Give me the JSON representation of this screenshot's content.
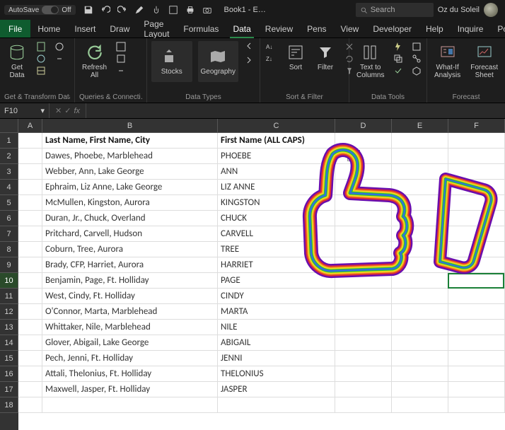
{
  "titlebar": {
    "autosave_label": "AutoSave",
    "autosave_state": "Off",
    "doc_title": "Book1 - E…",
    "search_placeholder": "Search",
    "user_name": "Oz du Soleil"
  },
  "tabs": {
    "file": "File",
    "items": [
      "Home",
      "Insert",
      "Draw",
      "Page Layout",
      "Formulas",
      "Data",
      "Review",
      "Pens",
      "View",
      "Developer",
      "Help",
      "Inquire",
      "Power"
    ],
    "active_index": 5
  },
  "ribbon": {
    "groups": {
      "get_transform": {
        "label": "Get & Transform Data",
        "get_data": "Get\nData"
      },
      "queries": {
        "label": "Queries & Connecti…",
        "refresh": "Refresh\nAll"
      },
      "data_types": {
        "label": "Data Types",
        "stocks": "Stocks",
        "geography": "Geography"
      },
      "sort_filter": {
        "label": "Sort & Filter",
        "sort": "Sort",
        "filter": "Filter"
      },
      "data_tools": {
        "label": "Data Tools",
        "text_to_columns": "Text to\nColumns"
      },
      "forecast": {
        "label": "Forecast",
        "what_if": "What-If\nAnalysis",
        "forecast_sheet": "Forecast\nSheet"
      }
    }
  },
  "namebox": {
    "ref": "F10"
  },
  "columns": [
    "A",
    "B",
    "C",
    "D",
    "E",
    "F"
  ],
  "col_classes": [
    "cA",
    "cB",
    "cC",
    "cD",
    "cE",
    "cF"
  ],
  "rows": [
    {
      "n": 1,
      "b": "Last Name, First Name, City",
      "c": "First Name (ALL CAPS)",
      "header": true
    },
    {
      "n": 2,
      "b": "Dawes, Phoebe, Marblehead",
      "c": "PHOEBE"
    },
    {
      "n": 3,
      "b": "Webber, Ann, Lake George",
      "c": "ANN"
    },
    {
      "n": 4,
      "b": "Ephraim, Liz Anne, Lake George",
      "c": "LIZ ANNE"
    },
    {
      "n": 5,
      "b": "McMullen, Kingston, Aurora",
      "c": "KINGSTON"
    },
    {
      "n": 6,
      "b": "Duran, Jr., Chuck, Overland",
      "c": "CHUCK"
    },
    {
      "n": 7,
      "b": "Pritchard, Carvell, Hudson",
      "c": "CARVELL"
    },
    {
      "n": 8,
      "b": "Coburn, Tree, Aurora",
      "c": "TREE"
    },
    {
      "n": 9,
      "b": "Brady, CFP, Harriet, Aurora",
      "c": "HARRIET"
    },
    {
      "n": 10,
      "b": "Benjamin, Page, Ft. Holliday",
      "c": "PAGE",
      "selected": true
    },
    {
      "n": 11,
      "b": "West, Cindy, Ft. Holliday",
      "c": "CINDY"
    },
    {
      "n": 12,
      "b": "O'Connor, Marta, Marblehead",
      "c": "MARTA"
    },
    {
      "n": 13,
      "b": "Whittaker, Nile, Marblehead",
      "c": "NILE"
    },
    {
      "n": 14,
      "b": "Glover, Abigail, Lake George",
      "c": "ABIGAIL"
    },
    {
      "n": 15,
      "b": "Pech, Jenni, Ft. Holliday",
      "c": "JENNI"
    },
    {
      "n": 16,
      "b": "Attali, Thelonius, Ft. Holliday",
      "c": "THELONIUS"
    },
    {
      "n": 17,
      "b": "Maxwell, Jasper, Ft. Holliday",
      "c": "JASPER"
    },
    {
      "n": 18,
      "b": "",
      "c": ""
    }
  ],
  "selected_cell": {
    "col": "F",
    "row": 10
  }
}
